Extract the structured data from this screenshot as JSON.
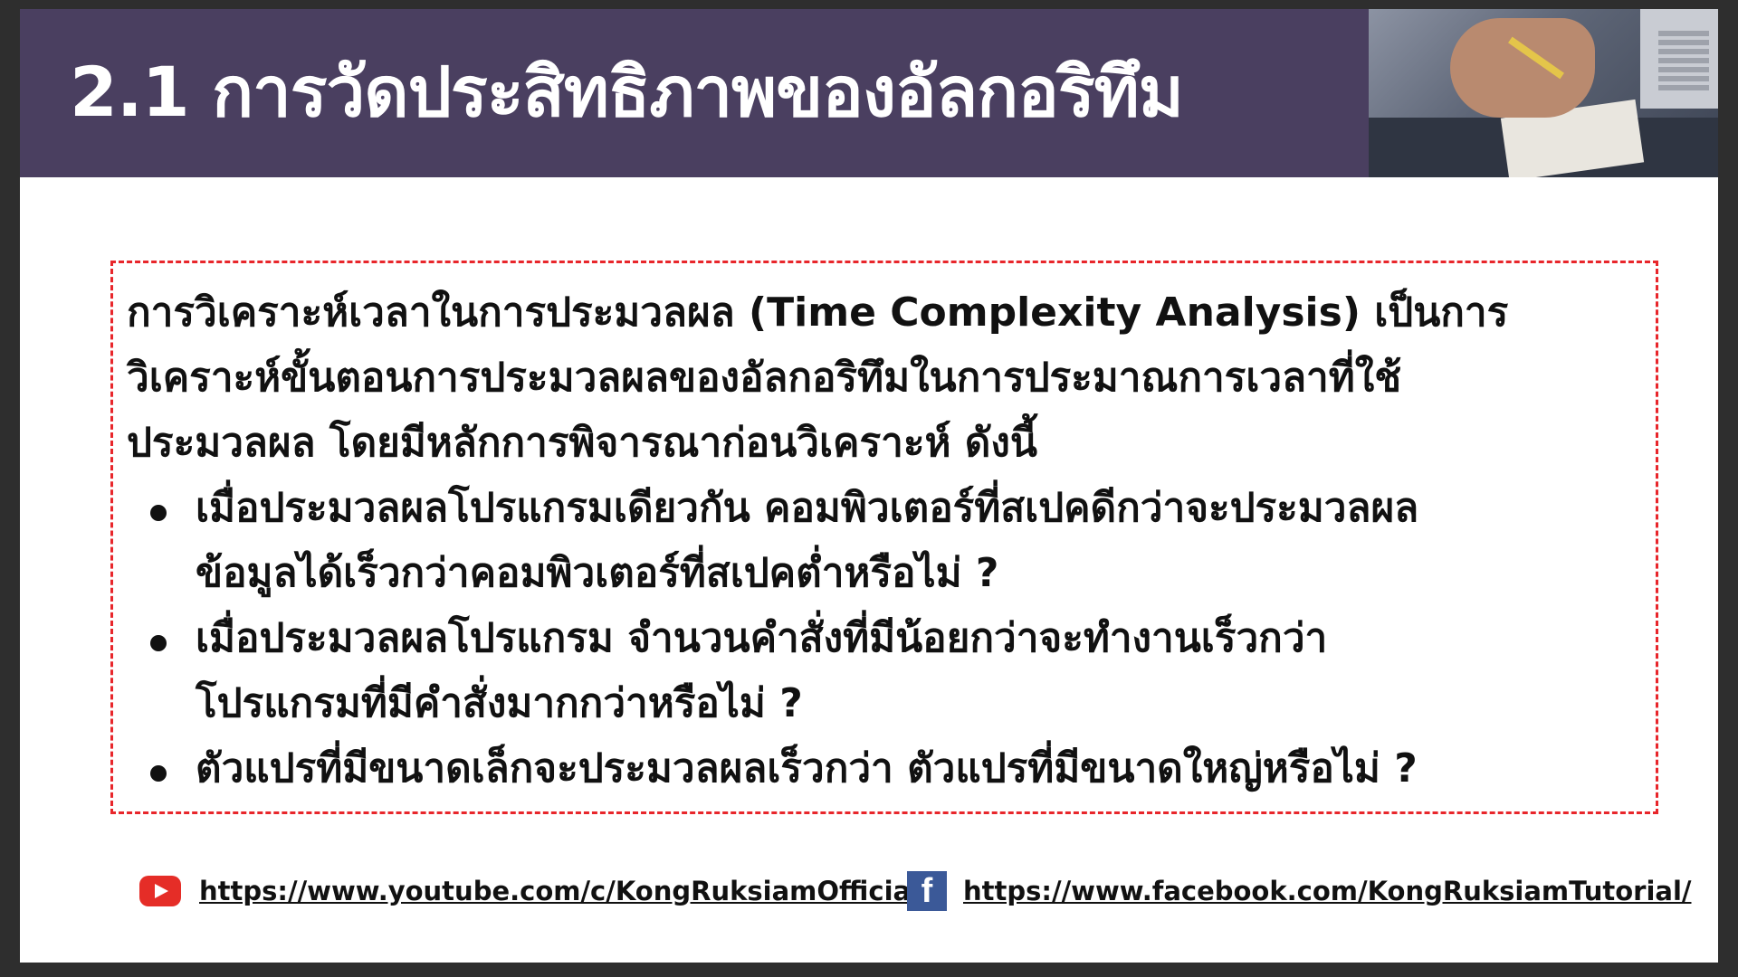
{
  "header": {
    "title": "2.1 การวัดประสิทธิภาพของอัลกอริทึม"
  },
  "content": {
    "intro_line1": "การวิเคราะห์เวลาในการประมวลผล (Time Complexity Analysis) เป็นการ",
    "intro_line2": "วิเคราะห์ขั้นตอนการประมวลผลของอัลกอริทึมในการประมาณการเวลาที่ใช้",
    "intro_line3": "ประมวลผล โดยมีหลักการพิจารณาก่อนวิเคราะห์ ดังนี้",
    "bullets": [
      {
        "line1": "เมื่อประมวลผลโปรแกรมเดียวกัน คอมพิวเตอร์ที่สเปคดีกว่าจะประมวลผล",
        "line2": "ข้อมูลได้เร็วกว่าคอมพิวเตอร์ที่สเปคต่ำหรือไม่ ?"
      },
      {
        "line1": "เมื่อประมวลผลโปรแกรม จำนวนคำสั่งที่มีน้อยกว่าจะทำงานเร็วกว่า",
        "line2": "โปรแกรมที่มีคำสั่งมากกว่าหรือไม่ ?"
      },
      {
        "line1": "ตัวแปรที่มีขนาดเล็กจะประมวลผลเร็วกว่า ตัวแปรที่มีขนาดใหญ่หรือไม่ ?"
      }
    ]
  },
  "footer": {
    "youtube_url": "https://www.youtube.com/c/KongRuksiamOfficial/",
    "facebook_url": "https://www.facebook.com/KongRuksiamTutorial/",
    "youtube_icon": "youtube-icon",
    "facebook_icon": "facebook-icon",
    "facebook_glyph": "f"
  },
  "colors": {
    "header_bg": "#4a3f60",
    "dashed_border": "#e8262b",
    "youtube_red": "#e52d27",
    "facebook_blue": "#3b5998"
  }
}
